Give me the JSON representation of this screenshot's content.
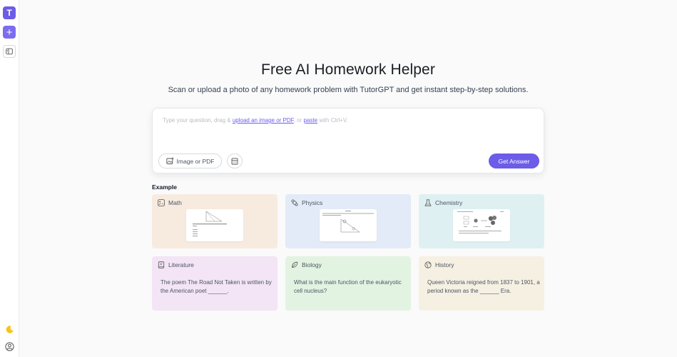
{
  "sidebar": {
    "logo_letter": "T",
    "new_symbol": "+"
  },
  "hero": {
    "title": "Free AI Homework Helper",
    "subtitle": "Scan or upload a photo of any homework problem with TutorGPT and get instant step-by-step solutions."
  },
  "input": {
    "placeholder_start": "Type your question, drag & ",
    "upload_link": "upload an image or PDF",
    "placeholder_mid": ", or ",
    "paste_link": "paste",
    "placeholder_end": " with Ctrl+V.",
    "image_button": "Image or PDF",
    "answer_button": "Get Answer"
  },
  "examples": {
    "label": "Example",
    "math": {
      "label": "Math"
    },
    "physics": {
      "label": "Physics"
    },
    "chemistry": {
      "label": "Chemistry"
    },
    "literature": {
      "label": "Literature",
      "text": "The poem The Road Not Taken is written by the American poet ______."
    },
    "biology": {
      "label": "Biology",
      "text": "What is the main function of the eukaryotic cell nucleus?"
    },
    "history": {
      "label": "History",
      "text": "Queen Victoria reigned from 1837 to 1901, a period known as the ______ Era."
    }
  },
  "colors": {
    "accent": "#6c5ce7",
    "math_bg": "#f7ebe0",
    "physics_bg": "#e2ebf7",
    "chemistry_bg": "#dff0f3",
    "literature_bg": "#f3e4f6",
    "biology_bg": "#e3f3e2",
    "history_bg": "#f6f0e2"
  }
}
